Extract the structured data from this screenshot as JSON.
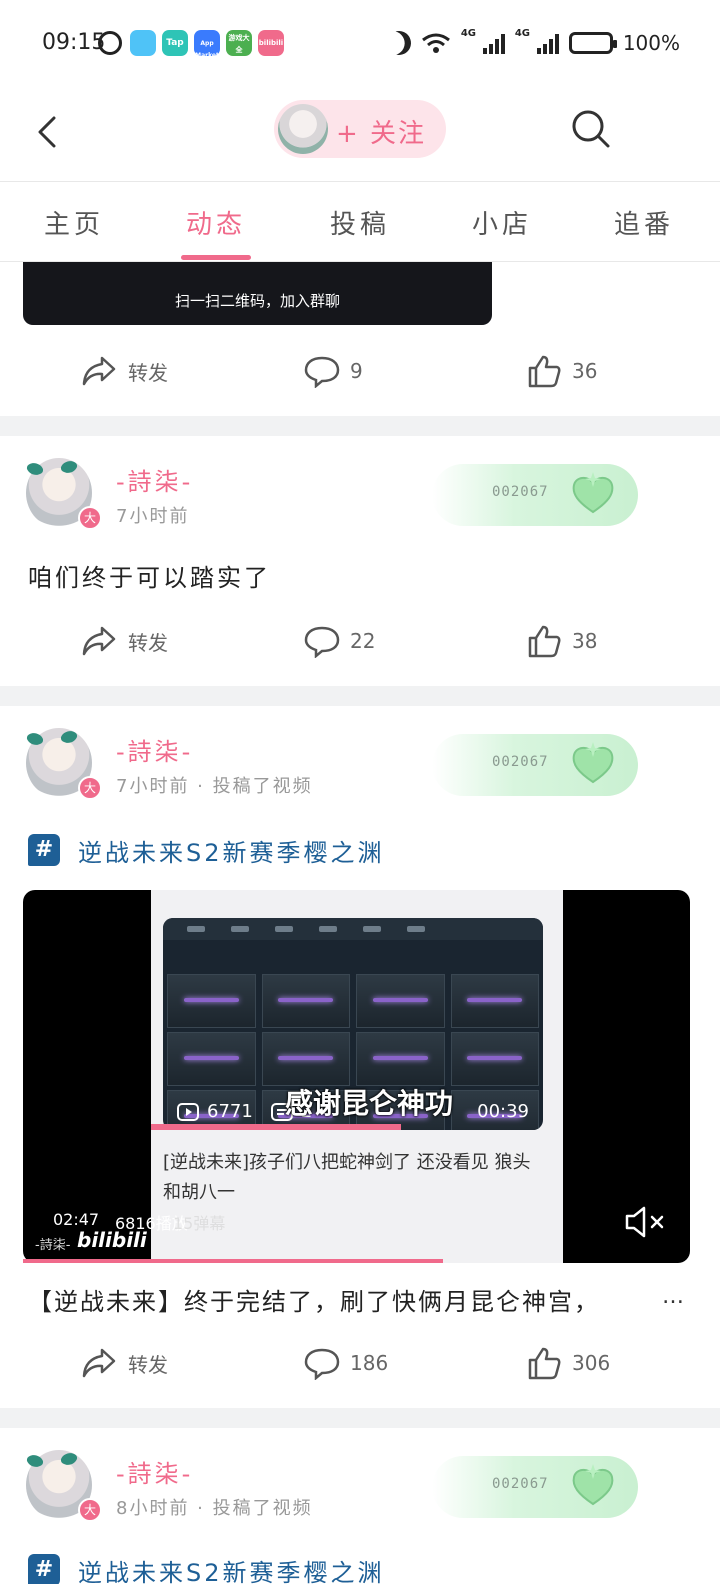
{
  "status_bar": {
    "time": "09:15",
    "apps": [
      {
        "name": "book-app-icon",
        "color": "#4fc3f7",
        "label": ""
      },
      {
        "name": "taptap-app-icon",
        "color": "#2ec4b6",
        "label": "Tap"
      },
      {
        "name": "app-market-icon",
        "color": "#3a7bfd",
        "label": "App Market"
      },
      {
        "name": "game-center-icon",
        "color": "#4caf50",
        "label": "游戏大全"
      },
      {
        "name": "bilibili-app-icon",
        "color": "#f06a8b",
        "label": "bilibili"
      }
    ],
    "network_1": "4G",
    "network_2": "4G",
    "battery": "100%"
  },
  "header": {
    "follow_label": "+ 关注"
  },
  "tabs": [
    {
      "label": "主页",
      "active": false
    },
    {
      "label": "动态",
      "active": true
    },
    {
      "label": "投稿",
      "active": false
    },
    {
      "label": "小店",
      "active": false
    },
    {
      "label": "追番",
      "active": false
    }
  ],
  "colors": {
    "accent": "#f06a8b",
    "topic": "#1e5f96",
    "muted": "#999999"
  },
  "feed": {
    "qr_banner_text": "扫一扫二维码，加入群聊",
    "post0": {
      "repost_label": "转发",
      "comment_count": "9",
      "like_count": "36"
    },
    "post1": {
      "username": "-詩柒-",
      "badge": "大",
      "time": "7小时前",
      "fan_number": "002067",
      "text": "咱们终于可以踏实了",
      "repost_label": "转发",
      "comment_count": "22",
      "like_count": "38"
    },
    "post2": {
      "username": "-詩柒-",
      "badge": "大",
      "time": "7小时前 · 投稿了视频",
      "fan_number": "002067",
      "topic_icon": "#",
      "topic": "逆战未来S2新赛季樱之渊",
      "video": {
        "thumb_views": "6771",
        "thumb_danmaku": "2",
        "thumb_duration": "00:39",
        "inner_title": "[逆战未来]孩子们八把蛇神剑了 还没看见 狼头和胡八一",
        "subtitle": "感谢昆仑神功",
        "duration": "02:47",
        "plays": "6816播放",
        "danmaku": "15弹幕",
        "watermark": "-詩柒-",
        "logo": "bilibili",
        "progress": 0.63
      },
      "description": "【逆战未来】终于完结了，刷了快俩月昆仑神宫，",
      "description_ellipsis": "…",
      "repost_label": "转发",
      "comment_count": "186",
      "like_count": "306"
    },
    "post3": {
      "username": "-詩柒-",
      "badge": "大",
      "time": "8小时前 · 投稿了视频",
      "fan_number": "002067",
      "topic": "逆战未来S2新赛季樱之渊"
    }
  }
}
